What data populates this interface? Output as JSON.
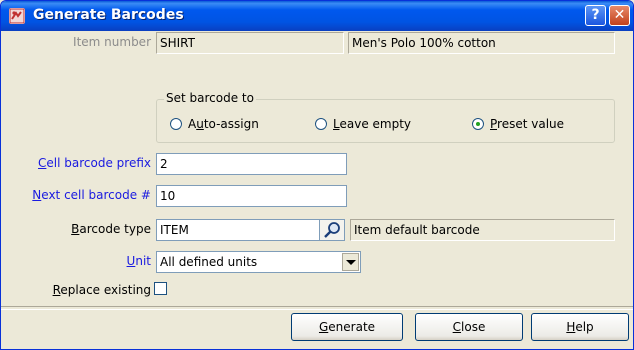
{
  "window": {
    "title": "Generate Barcodes",
    "help_glyph": "?",
    "close_glyph": "✕"
  },
  "item_number": {
    "label": "Item number",
    "code": "SHIRT",
    "description": "Men's Polo 100% cotton"
  },
  "set_barcode_to": {
    "caption": "Set barcode to",
    "options": [
      {
        "pre": "A",
        "key": "u",
        "post": "to-assign",
        "selected": false
      },
      {
        "pre": "",
        "key": "L",
        "post": "eave empty",
        "selected": false
      },
      {
        "pre": "",
        "key": "P",
        "post": "reset value",
        "selected": true
      }
    ]
  },
  "cell_barcode_prefix": {
    "label_key": "C",
    "label_rest": "ell barcode prefix",
    "value": "2"
  },
  "next_cell_barcode": {
    "label_key": "N",
    "label_rest": "ext cell barcode #",
    "value": "10"
  },
  "barcode_type": {
    "label_key": "B",
    "label_rest": "arcode type",
    "value": "ITEM",
    "description": "Item default barcode",
    "lookup_icon": "magnifier-icon"
  },
  "unit": {
    "label_key": "U",
    "label_rest": "nit",
    "selected": "All defined units"
  },
  "replace_existing": {
    "label_key": "R",
    "label_rest": "eplace existing",
    "checked": false
  },
  "buttons": [
    {
      "key": "G",
      "rest": "enerate"
    },
    {
      "key": "C",
      "rest": "lose"
    },
    {
      "key": "H",
      "rest": "elp"
    }
  ]
}
